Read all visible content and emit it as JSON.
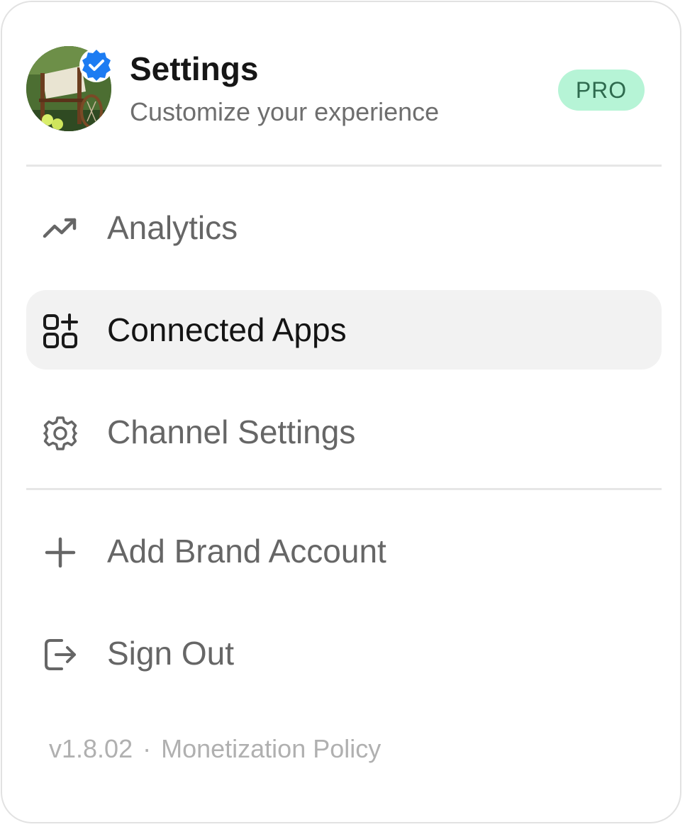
{
  "header": {
    "title": "Settings",
    "subtitle": "Customize your experience",
    "badge": "PRO",
    "verified": true
  },
  "menu": {
    "items": [
      {
        "label": "Analytics",
        "icon": "trending-up-icon",
        "active": false
      },
      {
        "label": "Connected Apps",
        "icon": "apps-add-icon",
        "active": true
      },
      {
        "label": "Channel Settings",
        "icon": "gear-icon",
        "active": false
      }
    ],
    "actions": [
      {
        "label": "Add Brand Account",
        "icon": "plus-icon"
      },
      {
        "label": "Sign Out",
        "icon": "sign-out-icon"
      }
    ]
  },
  "footer": {
    "version": "v1.8.02",
    "separator": "·",
    "policy_link": "Monetization Policy"
  },
  "colors": {
    "badge_bg": "#b6f4d6",
    "badge_text": "#2e6a4e",
    "verified": "#1d7cf2",
    "active_bg": "#f2f2f2"
  }
}
